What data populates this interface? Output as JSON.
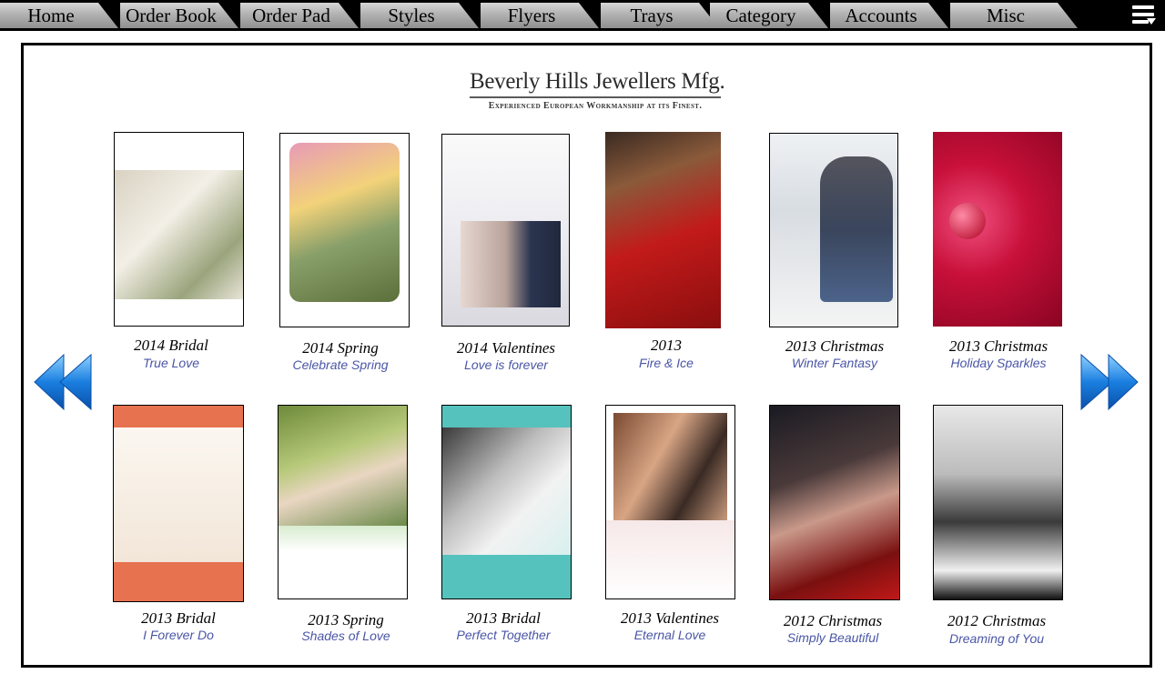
{
  "nav": {
    "tabs": [
      {
        "label": "Home"
      },
      {
        "label": "Order Book"
      },
      {
        "label": "Order Pad"
      },
      {
        "label": "Styles"
      },
      {
        "label": "Flyers"
      },
      {
        "label": "Trays"
      },
      {
        "label": "Category"
      },
      {
        "label": "Accounts"
      },
      {
        "label": "Misc"
      }
    ]
  },
  "brand": {
    "name": "Beverly Hills Jewellers Mfg.",
    "tagline": "Experienced European Workmanship at its Finest."
  },
  "flyers": [
    {
      "title": "2014 Bridal",
      "subtitle": "True Love"
    },
    {
      "title": "2014 Spring",
      "subtitle": "Celebrate Spring"
    },
    {
      "title": "2014 Valentines",
      "subtitle": "Love is forever"
    },
    {
      "title": "2013",
      "subtitle": "Fire & Ice"
    },
    {
      "title": "2013 Christmas",
      "subtitle": "Winter Fantasy"
    },
    {
      "title": "2013 Christmas",
      "subtitle": "Holiday Sparkles"
    },
    {
      "title": "2013 Bridal",
      "subtitle": "I Forever Do"
    },
    {
      "title": "2013 Spring",
      "subtitle": "Shades of Love"
    },
    {
      "title": "2013 Bridal",
      "subtitle": "Perfect Together"
    },
    {
      "title": "2013 Valentines",
      "subtitle": "Eternal Love"
    },
    {
      "title": "2012 Christmas",
      "subtitle": "Simply Beautiful"
    },
    {
      "title": "2012 Christmas",
      "subtitle": "Dreaming of You"
    }
  ],
  "colors": {
    "subtitle": "#4a56a6",
    "arrow": "#1a7fe0"
  },
  "icons": {
    "prev": "double-chevron-left-icon",
    "next": "double-chevron-right-icon",
    "menu": "hamburger-menu-icon"
  }
}
